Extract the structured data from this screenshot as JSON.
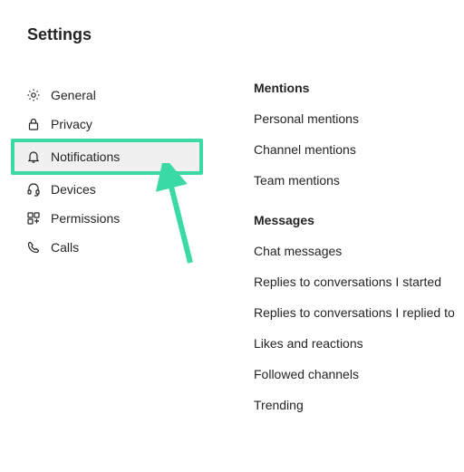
{
  "title": "Settings",
  "sidebar": {
    "items": [
      {
        "id": "general",
        "label": "General"
      },
      {
        "id": "privacy",
        "label": "Privacy"
      },
      {
        "id": "notifications",
        "label": "Notifications"
      },
      {
        "id": "devices",
        "label": "Devices"
      },
      {
        "id": "permissions",
        "label": "Permissions"
      },
      {
        "id": "calls",
        "label": "Calls"
      }
    ],
    "selected": "notifications"
  },
  "panel": {
    "sections": [
      {
        "header": "Mentions",
        "options": [
          "Personal mentions",
          "Channel mentions",
          "Team mentions"
        ]
      },
      {
        "header": "Messages",
        "options": [
          "Chat messages",
          "Replies to conversations I started",
          "Replies to conversations I replied to",
          "Likes and reactions",
          "Followed channels",
          "Trending"
        ]
      }
    ]
  },
  "annotation": {
    "highlight_color": "#3ad9a5",
    "arrow_color": "#3ad9a5"
  }
}
